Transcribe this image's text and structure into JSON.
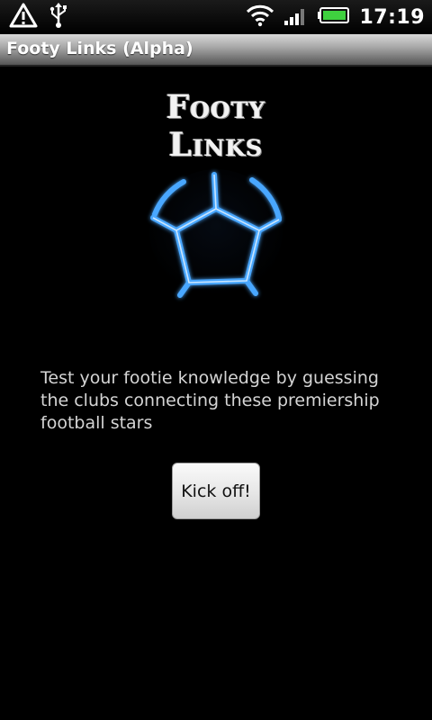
{
  "status_bar": {
    "time": "17:19",
    "icons": [
      "alert-triangle-icon",
      "usb-icon",
      "wifi-icon",
      "signal-icon",
      "battery-icon"
    ]
  },
  "app": {
    "title": "Footy Links (Alpha)"
  },
  "logo": {
    "line1": "Footy",
    "line2": "Links",
    "image": "soccer-ball-icon",
    "accent_color": "#4aa8ff"
  },
  "main": {
    "description": "Test your footie knowledge by guessing the clubs connecting these premiership football stars",
    "button_label": "Kick off!"
  }
}
